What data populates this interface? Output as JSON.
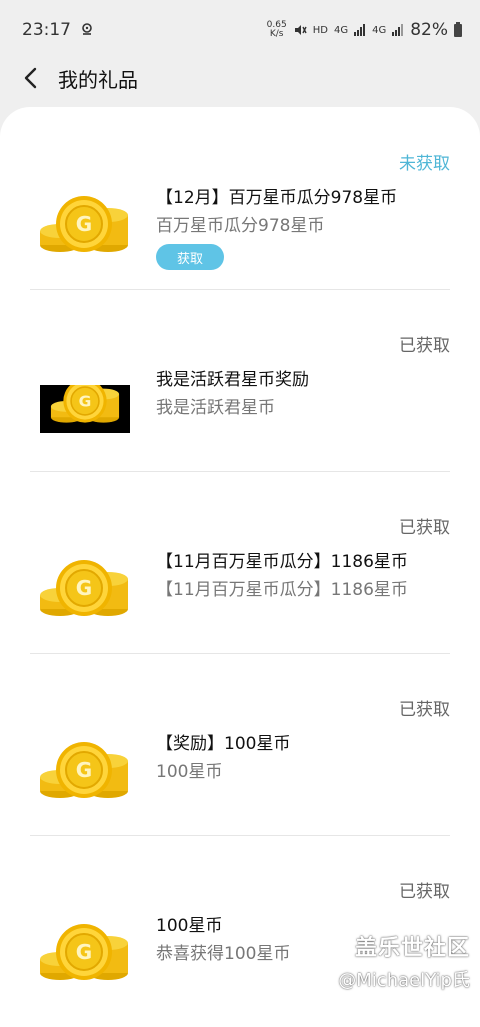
{
  "status_bar": {
    "time": "23:17",
    "net_speed_value": "0.65",
    "net_speed_unit": "K/s",
    "hd_label": "HD",
    "network_1": "4G",
    "network_2": "4G",
    "battery": "82%"
  },
  "header": {
    "title": "我的礼品",
    "back_icon": "chevron-left-icon"
  },
  "gifts": [
    {
      "status": "未获取",
      "title": "【12月】百万星币瓜分978星币",
      "subtitle": "百万星币瓜分978星币",
      "claim_label": "获取"
    },
    {
      "status": "已获取",
      "title": "我是活跃君星币奖励",
      "subtitle": "我是活跃君星币"
    },
    {
      "status": "已获取",
      "title": "【11月百万星币瓜分】1186星币",
      "subtitle": "【11月百万星币瓜分】1186星币"
    },
    {
      "status": "已获取",
      "title": "【奖励】100星币",
      "subtitle": "100星币"
    },
    {
      "status": "已获取",
      "title": "100星币",
      "subtitle": "恭喜获得100星币"
    }
  ],
  "watermark": {
    "logo": "盖乐世社区",
    "user": "@MichaelYip氏"
  },
  "colors": {
    "unclaimed": "#4fb6d6",
    "claim_button": "#5fc4e6",
    "coin_gold": "#f5c518"
  }
}
